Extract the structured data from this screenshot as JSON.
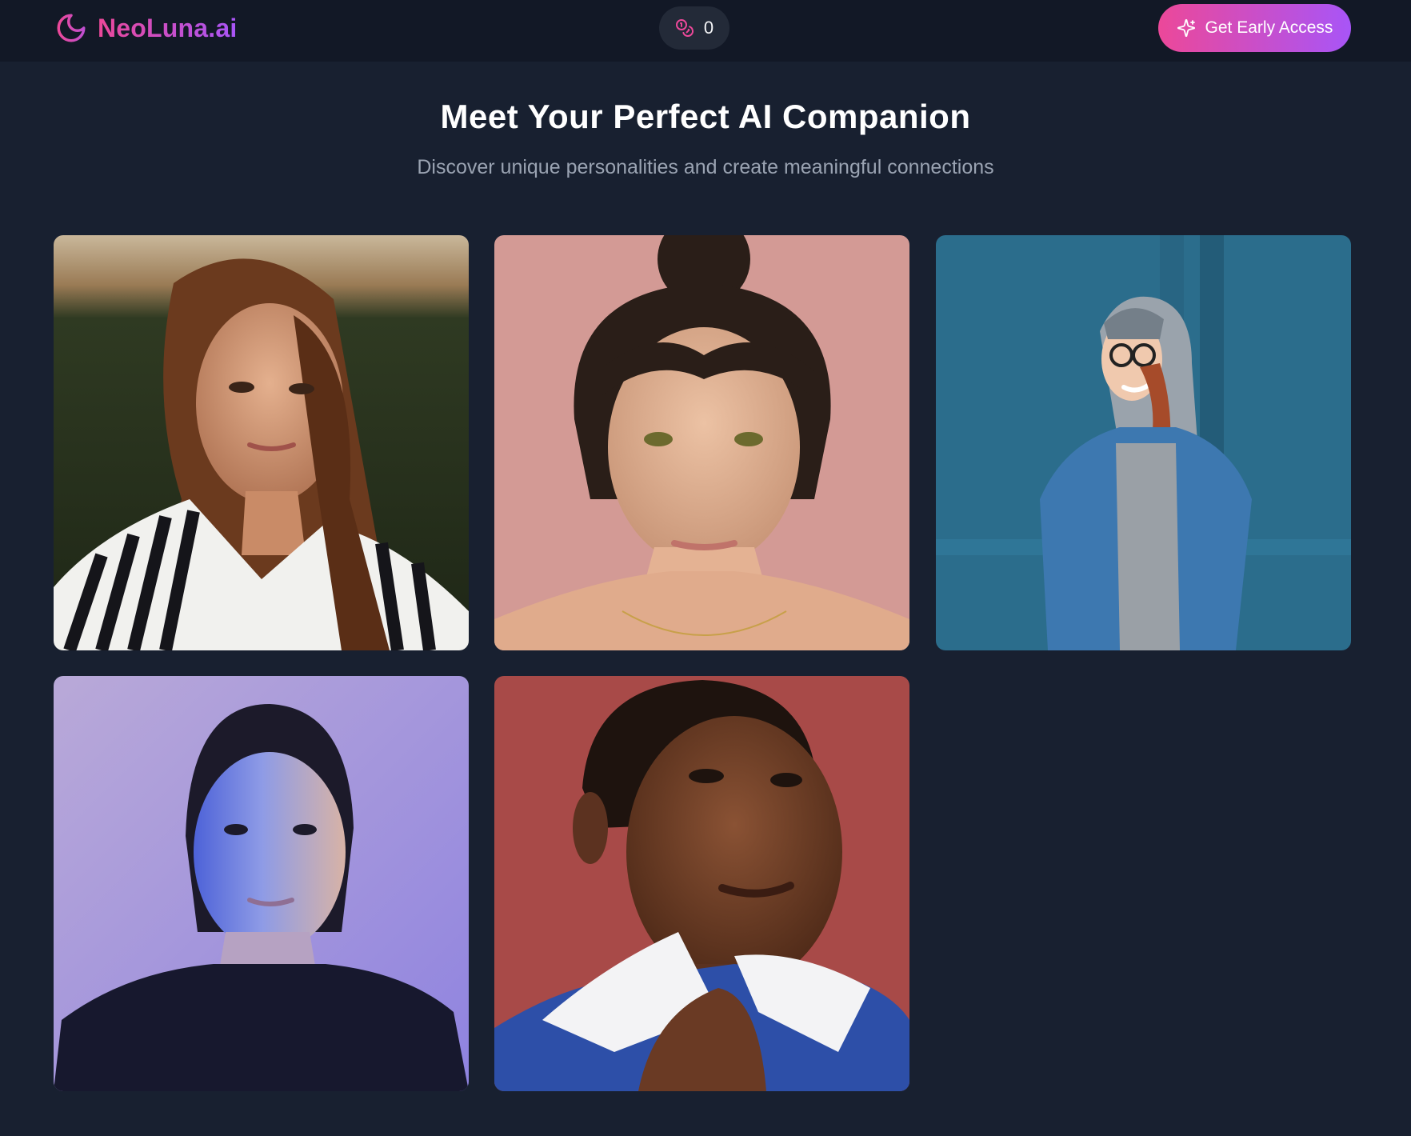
{
  "nav": {
    "brand_name": "NeoLuna.ai",
    "brand_icon": "moon-icon",
    "credits_icon": "coins-icon",
    "credits_count": "0",
    "cta_icon": "sparkles-icon",
    "cta_label": "Get Early Access"
  },
  "hero": {
    "title": "Meet Your Perfect AI Companion",
    "subtitle": "Discover unique personalities and create meaningful connections"
  },
  "companions": [
    {
      "photo": "portrait-1"
    },
    {
      "photo": "portrait-2"
    },
    {
      "photo": "portrait-3"
    },
    {
      "photo": "portrait-4"
    },
    {
      "photo": "portrait-5"
    }
  ],
  "colors": {
    "background": "#182030",
    "navbar": "#121826",
    "accent_start": "#ec4899",
    "accent_end": "#a855f7"
  }
}
